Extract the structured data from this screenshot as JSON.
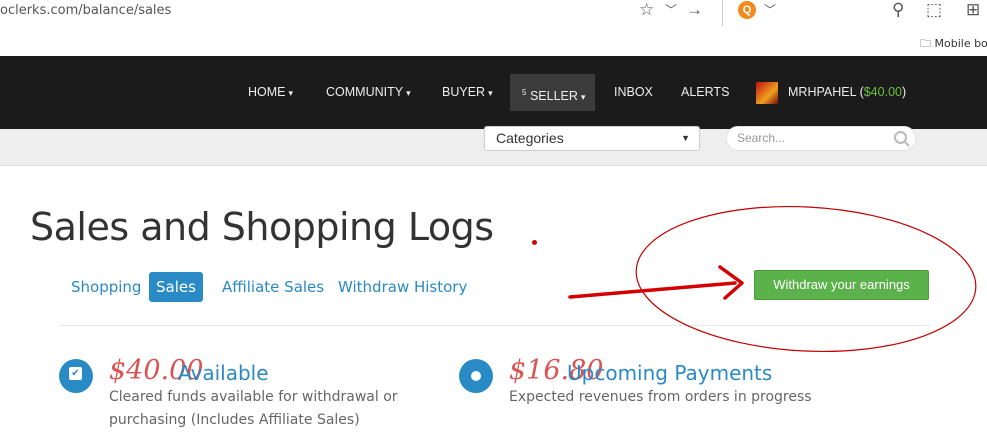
{
  "browser": {
    "url": "oclerks.com/balance/sales",
    "mobile_bookmarks": "Mobile bo"
  },
  "nav": {
    "home": "HOME",
    "community": "COMMUNITY",
    "buyer": "BUYER",
    "seller_badge": "5",
    "seller": "SELLER",
    "inbox": "INBOX",
    "alerts": "ALERTS",
    "username": "MRHPAHEL",
    "balance_open": "(",
    "balance": "$40.00",
    "balance_close": ")"
  },
  "subbar": {
    "categories": "Categories",
    "search_placeholder": "Search..."
  },
  "page": {
    "title": "Sales and Shopping Logs",
    "tabs": [
      "Shopping",
      "Sales",
      "Affiliate Sales",
      "Withdraw History"
    ],
    "active_tab": "Sales",
    "withdraw_button": "Withdraw your earnings"
  },
  "stats": {
    "available": {
      "amount": "$40.00",
      "title": "Available",
      "desc_line1": "Cleared funds available for withdrawal or",
      "desc_line2": "purchasing (Includes Affiliate Sales)"
    },
    "upcoming": {
      "amount": "$16.80",
      "title": "Upcoming Payments",
      "desc": "Expected revenues from orders in progress"
    }
  },
  "colors": {
    "navbar": "#1b1b1b",
    "accent": "#2a8ac5",
    "withdraw_green": "#5cb24a",
    "amount_red": "#d9534f",
    "annotation_red": "#d40000"
  }
}
